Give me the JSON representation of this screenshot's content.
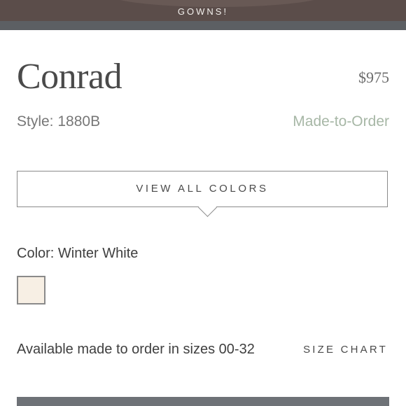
{
  "banner": {
    "text": "GOWNS!"
  },
  "product": {
    "name": "Conrad",
    "price": "$975",
    "style": "Style: 1880B",
    "availability": "Made-to-Order"
  },
  "colors": {
    "view_all_label": "VIEW ALL COLORS",
    "selected_label": "Color: Winter White",
    "swatches": [
      {
        "name": "Winter White",
        "hex": "#f7efe4"
      }
    ]
  },
  "sizes": {
    "text": "Available made to order in sizes 00-32",
    "chart_label": "SIZE CHART"
  },
  "theme": {
    "banner_bg": "#5b4d4a",
    "accent_green": "#a7b7a6",
    "bottom_button_bg": "#6e7277"
  }
}
